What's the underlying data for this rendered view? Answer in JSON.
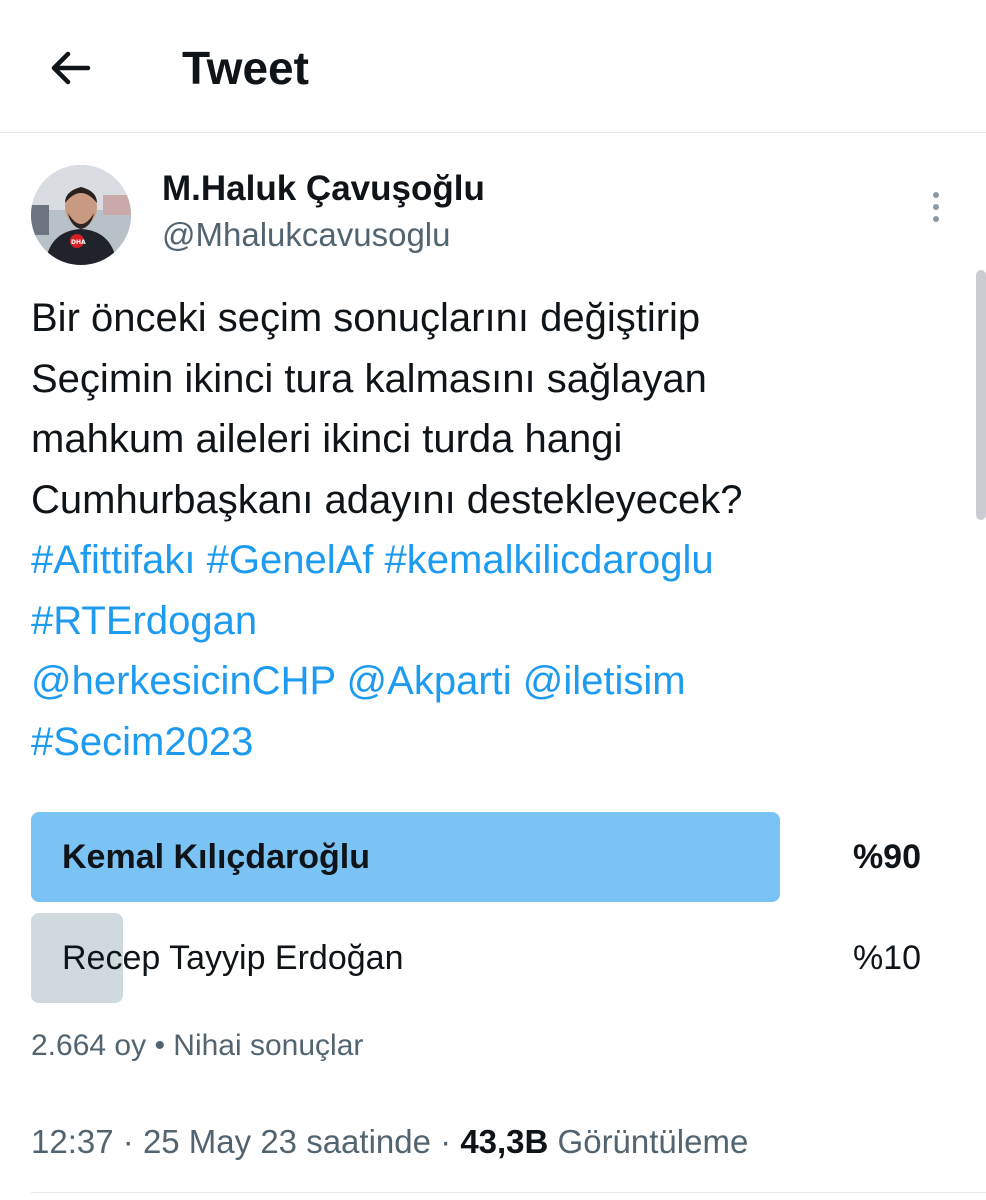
{
  "header": {
    "title": "Tweet",
    "back_icon": "arrow-left-icon"
  },
  "author": {
    "name": "M.Haluk Çavuşoğlu",
    "handle": "@Mhalukcavusoglu",
    "avatar_icon": "avatar-photo",
    "avatar_badge": "DHA",
    "more_icon": "more-vertical-icon"
  },
  "tweet": {
    "lines": [
      "Bir önceki seçim sonuçlarını değiştirip",
      "Seçimin ikinci tura kalmasını sağlayan",
      "mahkum aileleri ikinci turda hangi",
      "Cumhurbaşkanı adayını destekleyecek?"
    ],
    "link_lines": [
      [
        "#Afittifakı",
        "#GenelAf",
        "#kemalkilicdaroglu"
      ],
      [
        "#RTErdogan"
      ],
      [
        "@herkesicinCHP",
        "@Akparti",
        "@iletisim"
      ],
      [
        "#Secim2023"
      ]
    ]
  },
  "poll": {
    "options": [
      {
        "label": "Kemal Kılıçdaroğlu",
        "percent_text": "%90",
        "fraction": 0.9,
        "winner": true
      },
      {
        "label": "Recep Tayyip Erdoğan",
        "percent_text": "%10",
        "fraction": 0.1,
        "winner": false
      }
    ],
    "votes": "2.664 oy",
    "status": "Nihai sonuçlar",
    "separator": "•"
  },
  "meta": {
    "time": "12:37",
    "date": "25 May 23 saatinde",
    "views_count": "43,3B",
    "views_label": "Görüntüleme",
    "separator": "·"
  },
  "colors": {
    "winner_bar": "#7cc3f5",
    "loser_bar": "#cfd9de",
    "link": "#1d9bf0",
    "secondary_text": "#536471"
  }
}
